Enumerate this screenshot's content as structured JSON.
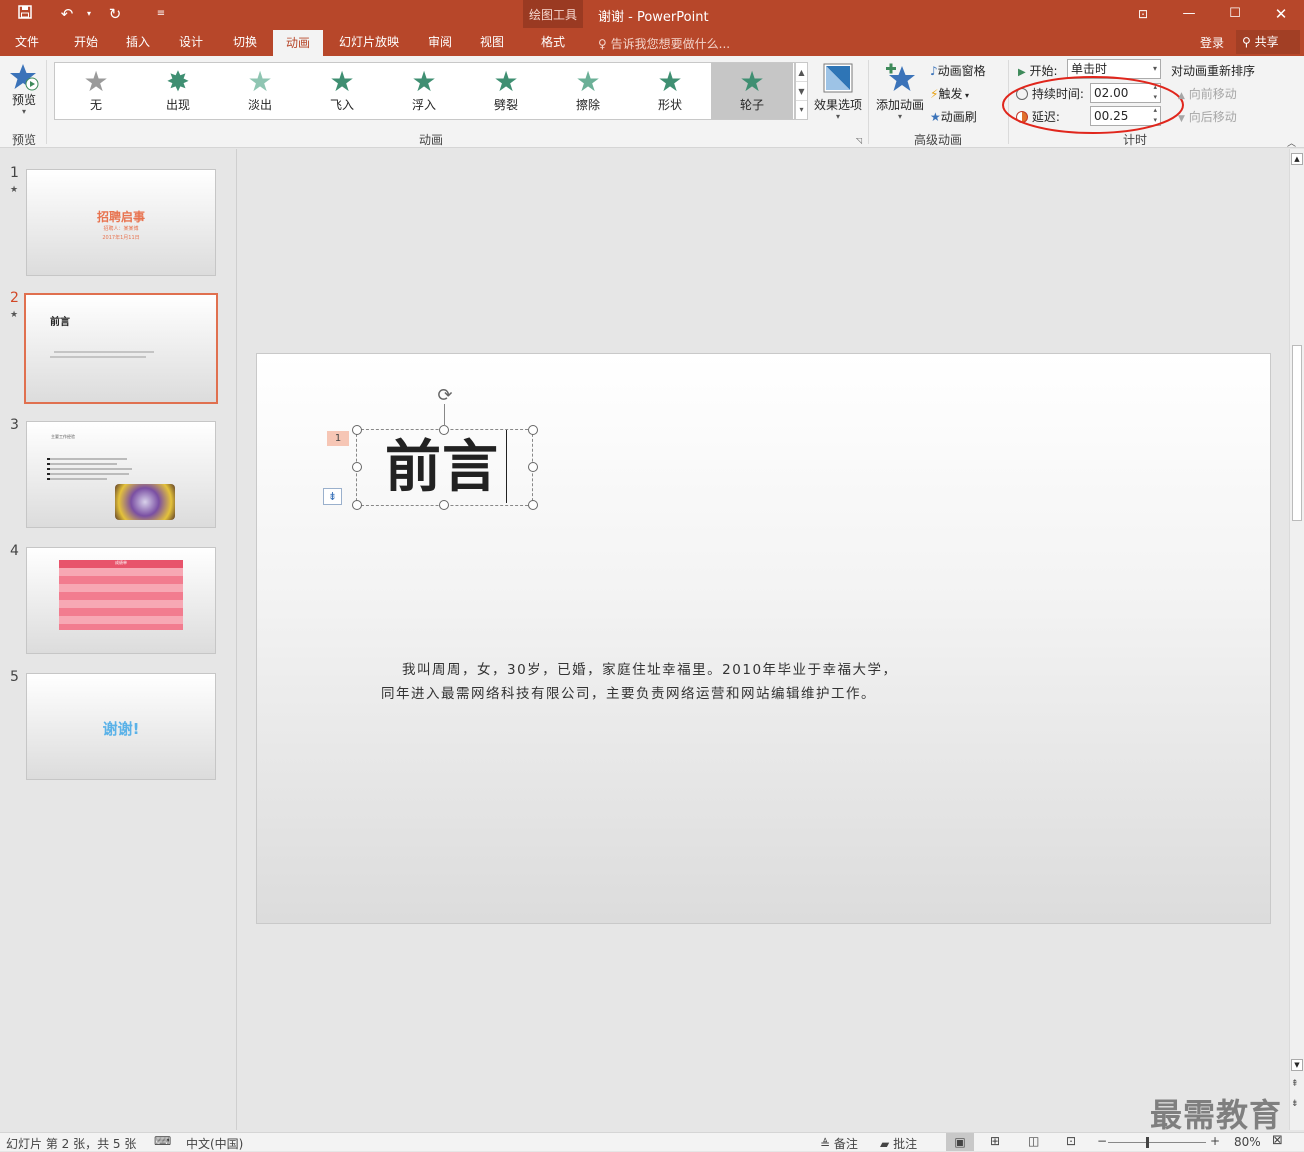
{
  "app": {
    "title": "谢谢 - PowerPoint",
    "context_group": "绘图工具",
    "quick_access": {
      "save_icon": "save-icon",
      "undo_icon": "undo-icon",
      "redo_icon": "redo-icon",
      "customize_icon": "customize-qat-icon"
    }
  },
  "tabs": [
    {
      "label": "文件"
    },
    {
      "label": "开始"
    },
    {
      "label": "插入"
    },
    {
      "label": "设计"
    },
    {
      "label": "切换"
    },
    {
      "label": "动画",
      "active": true
    },
    {
      "label": "幻灯片放映"
    },
    {
      "label": "审阅"
    },
    {
      "label": "视图"
    },
    {
      "label": "格式"
    }
  ],
  "tell_me": "告诉我您想要做什么...",
  "account": {
    "signin": "登录",
    "share": "共享"
  },
  "ribbon": {
    "preview": {
      "label": "预览",
      "group": "预览"
    },
    "animations": {
      "group": "动画",
      "items": [
        {
          "label": "无",
          "color": "#9a9a9a"
        },
        {
          "label": "出现",
          "color": "#3f8f72"
        },
        {
          "label": "淡出",
          "color": "#8fc5b2"
        },
        {
          "label": "飞入",
          "color": "#3f8f72"
        },
        {
          "label": "浮入",
          "color": "#3f8f72"
        },
        {
          "label": "劈裂",
          "color": "#3f8f72"
        },
        {
          "label": "擦除",
          "color": "#6bb097"
        },
        {
          "label": "形状",
          "color": "#3f8f72"
        },
        {
          "label": "轮子",
          "color": "#3f8f72",
          "selected": true
        }
      ]
    },
    "effect_options": "效果选项",
    "advanced": {
      "group": "高级动画",
      "add_animation": "添加动画",
      "pane": "动画窗格",
      "trigger": "触发",
      "painter": "动画刷"
    },
    "timing": {
      "group": "计时",
      "start_label": "开始:",
      "start_value": "单击时",
      "duration_label": "持续时间:",
      "duration_value": "02.00",
      "delay_label": "延迟:",
      "delay_value": "00.25",
      "reorder": "对动画重新排序",
      "move_earlier": "向前移动",
      "move_later": "向后移动"
    }
  },
  "thumbnails": [
    {
      "num": "1",
      "title": "招聘启事",
      "line1": "招聘人：某某博",
      "line2": "2017年1月11日"
    },
    {
      "num": "2",
      "title": "前言"
    },
    {
      "num": "3",
      "title": "主要工作经验"
    },
    {
      "num": "4",
      "title": "成绩单"
    },
    {
      "num": "5",
      "title": "谢谢!"
    }
  ],
  "slide": {
    "title": "前言",
    "anim_number": "1",
    "body_line1": "我叫周周，女，30岁，已婚，家庭住址幸福里。2010年毕业于幸福大学，",
    "body_line2": "同年进入最需网络科技有限公司，主要负责网络运营和网站编辑维护工作。"
  },
  "status": {
    "slide_info": "幻灯片 第 2 张，共 5 张",
    "language": "中文(中国)",
    "notes": "备注",
    "comments": "批注",
    "zoom": "80%"
  },
  "watermark": "最需教育",
  "colors": {
    "accent": "#b7472a",
    "highlight_circle": "#e0261c"
  }
}
